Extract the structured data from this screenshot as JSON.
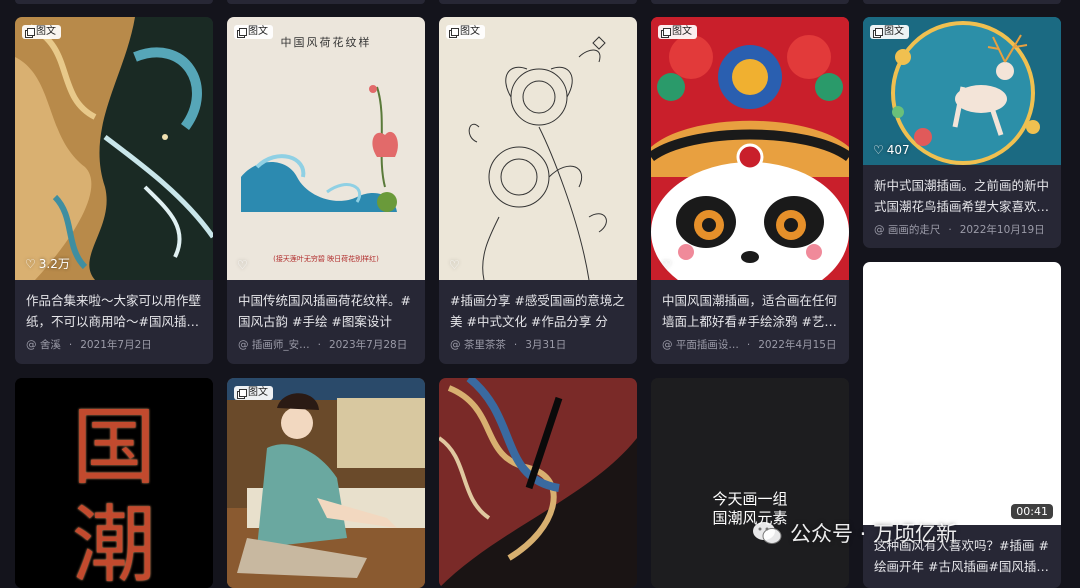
{
  "badge_label": "图文",
  "cards_row1": [
    {
      "title": "作品合集来啦～大家可以用作壁纸，不可以商用哈～#国风插…",
      "author": "@ 舍溪",
      "date": "2021年7月2日",
      "likes": "3.2万",
      "icon": "heart-icon"
    },
    {
      "title": "中国传统国风插画荷花纹样。#国风古韵 #手绘 #图案设计 #…",
      "author": "@ 插画师_安…",
      "date": "2023年7月28日",
      "likes": "",
      "art_title": "中国风荷花纹样",
      "art_caption": "(接天莲叶无穷碧 映日荷花别样红)"
    },
    {
      "title": "#插画分享 #感受国画的意境之美 #中式文化 #作品分享 分享…",
      "author": "@ 茶里茶茶",
      "date": "3月31日",
      "likes": ""
    },
    {
      "title": "中国风国潮插画，适合画在任何墙面上都好看#手绘涂鸦 #艺…",
      "author": "@ 平面插画设…",
      "date": "2022年4月15日",
      "likes": ""
    },
    {
      "title": "新中式国潮插画。之前画的新中式国潮花鸟插画希望大家喜欢…",
      "author": "@ 画画的走尺",
      "date": "2022年10月19日",
      "likes": "407"
    }
  ],
  "cards_row2": [
    {
      "art_text": "国潮"
    },
    {},
    {},
    {
      "art_text_line1": "今天画一组",
      "art_text_line2": "国潮风元素"
    },
    {
      "title": "这种画风有人喜欢吗？#插画 #绘画开年 #古风插画#国风插…",
      "duration": "00:41"
    }
  ],
  "watermark": "公众号 · 万顷亿新",
  "colors": {
    "background": "#14141c",
    "card": "#272735",
    "text": "#e6e6ea",
    "meta": "#9b9ba8"
  }
}
